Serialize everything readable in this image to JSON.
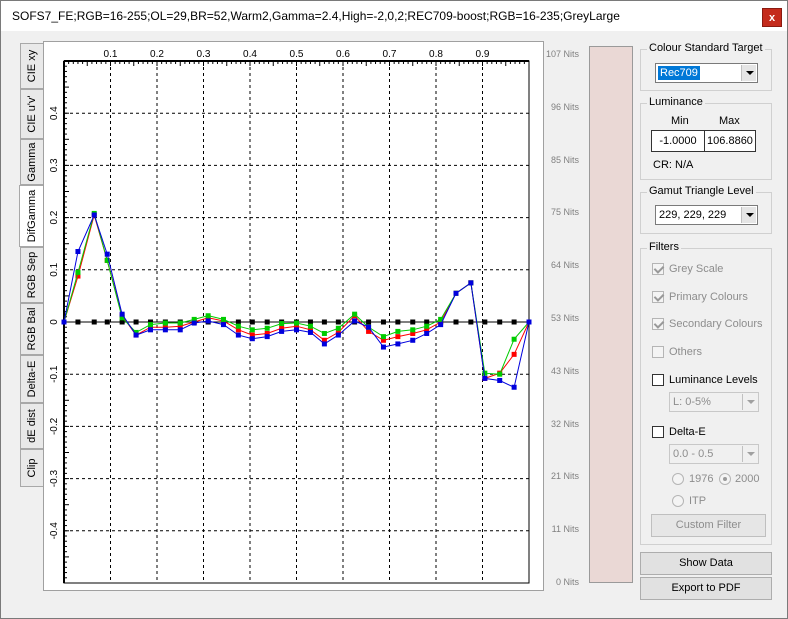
{
  "window": {
    "title": "SOFS7_FE;RGB=16-255;OL=29,BR=52,Warm2,Gamma=2.4,High=-2,0,2;REC709-boost;RGB=16-235;GreyLarge",
    "close_label": "x"
  },
  "tabs": [
    "CIE xy",
    "CIE u'v'",
    "Gamma",
    "DifGamma",
    "RGB Sep",
    "RGB Bal",
    "Delta-E",
    "dE dist",
    "Clip"
  ],
  "active_tab": "DifGamma",
  "chart_data": {
    "type": "line",
    "title": "",
    "xlabel": "",
    "ylabel": "",
    "xlim": [
      0,
      1
    ],
    "ylim": [
      -0.5,
      0.5
    ],
    "x_ticks": [
      "0.1",
      "0.2",
      "0.3",
      "0.4",
      "0.5",
      "0.6",
      "0.7",
      "0.8",
      "0.9"
    ],
    "y_ticks": [
      "0.4",
      "0.3",
      "0.2",
      "0.1",
      "0",
      "-0.1",
      "-0.2",
      "-0.3",
      "-0.4"
    ],
    "grid": true,
    "x": [
      0.0,
      0.03,
      0.065,
      0.093,
      0.125,
      0.155,
      0.186,
      0.218,
      0.25,
      0.28,
      0.31,
      0.343,
      0.375,
      0.405,
      0.437,
      0.468,
      0.5,
      0.53,
      0.56,
      0.59,
      0.625,
      0.655,
      0.687,
      0.718,
      0.75,
      0.78,
      0.81,
      0.843,
      0.875,
      0.905,
      0.937,
      0.968,
      1.0
    ],
    "series": [
      {
        "color": "#ff0000",
        "values": [
          0,
          0.088,
          0.205,
          0.118,
          0.012,
          -0.025,
          -0.01,
          -0.01,
          -0.008,
          0.0,
          0.008,
          0.002,
          -0.015,
          -0.025,
          -0.022,
          -0.012,
          -0.008,
          -0.015,
          -0.035,
          -0.02,
          0.012,
          -0.018,
          -0.035,
          -0.028,
          -0.022,
          -0.015,
          0.0,
          0.055,
          0.075,
          -0.108,
          -0.098,
          -0.062,
          0
        ]
      },
      {
        "color": "#00cc00",
        "values": [
          0,
          0.095,
          0.208,
          0.118,
          0.008,
          -0.02,
          -0.005,
          -0.002,
          -0.002,
          0.005,
          0.012,
          0.005,
          -0.008,
          -0.015,
          -0.012,
          -0.003,
          -0.002,
          -0.008,
          -0.022,
          -0.012,
          0.015,
          -0.01,
          -0.028,
          -0.018,
          -0.015,
          -0.008,
          0.005,
          0.055,
          0.075,
          -0.098,
          -0.1,
          -0.033,
          0
        ]
      },
      {
        "color": "#0000dd",
        "values": [
          0,
          0.135,
          0.205,
          0.13,
          0.015,
          -0.025,
          -0.015,
          -0.015,
          -0.015,
          -0.002,
          0.002,
          -0.005,
          -0.025,
          -0.032,
          -0.028,
          -0.018,
          -0.015,
          -0.02,
          -0.042,
          -0.025,
          0.002,
          -0.01,
          -0.048,
          -0.042,
          -0.035,
          -0.022,
          -0.005,
          0.055,
          0.075,
          -0.108,
          -0.112,
          -0.125,
          0
        ]
      },
      {
        "color": "#000000",
        "values": [
          0,
          0,
          0,
          0,
          0,
          0,
          0,
          0,
          0,
          0,
          0,
          0,
          0,
          0,
          0,
          0,
          0,
          0,
          0,
          0,
          0,
          0,
          0,
          0,
          0,
          0,
          0,
          0,
          0,
          0,
          0,
          0,
          0
        ]
      }
    ]
  },
  "nits_scale": [
    "107 Nits",
    "96 Nits",
    "85 Nits",
    "75 Nits",
    "64 Nits",
    "53 Nits",
    "43 Nits",
    "32 Nits",
    "21 Nits",
    "11 Nits",
    "0 Nits"
  ],
  "colour_standard": {
    "title": "Colour Standard Target",
    "value": "Rec709"
  },
  "luminance": {
    "title": "Luminance",
    "min_label": "Min",
    "max_label": "Max",
    "min_value": "-1.0000",
    "max_value": "106.8860",
    "cr_label": "CR: N/A"
  },
  "gamut": {
    "title": "Gamut Triangle Level",
    "value": "229, 229, 229"
  },
  "filters": {
    "title": "Filters",
    "grey_scale": "Grey Scale",
    "primary_colours": "Primary Colours",
    "secondary_colours": "Secondary Colours",
    "others": "Others",
    "luminance_levels": "Luminance Levels",
    "luminance_level_value": "L:   0-5%",
    "delta_e": "Delta-E",
    "delta_e_value": "0.0 - 0.5",
    "opt_1976": "1976",
    "opt_2000": "2000",
    "opt_itp": "ITP",
    "custom_filter": "Custom Filter"
  },
  "buttons": {
    "show_data": "Show Data",
    "export_pdf": "Export to PDF"
  }
}
